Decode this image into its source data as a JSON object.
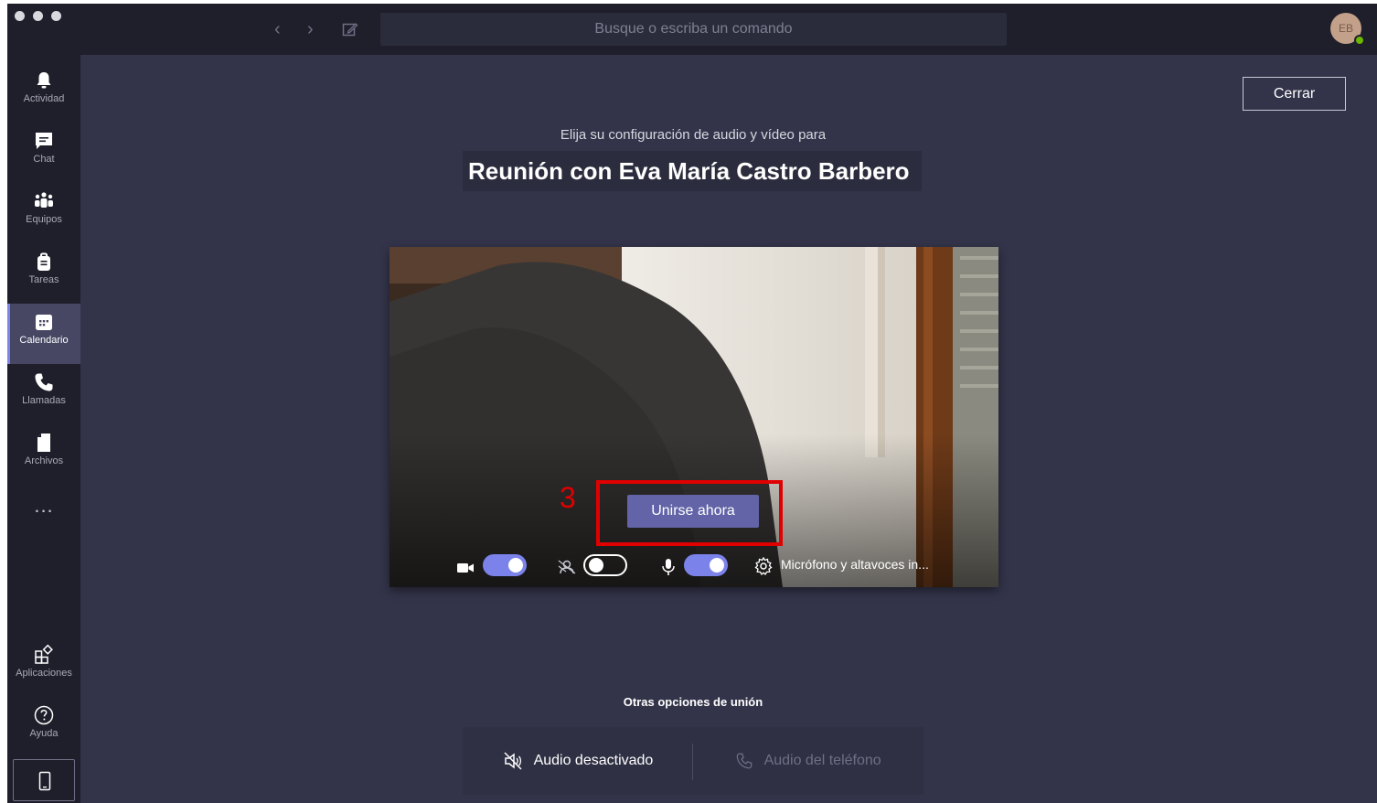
{
  "titlebar": {
    "search_placeholder": "Busque o escriba un comando",
    "avatar_initials": "EB",
    "presence_color": "#6bb700"
  },
  "rail": {
    "items": [
      {
        "label": "Actividad",
        "icon": "bell-icon"
      },
      {
        "label": "Chat",
        "icon": "chat-icon"
      },
      {
        "label": "Equipos",
        "icon": "teams-icon"
      },
      {
        "label": "Tareas",
        "icon": "tasks-icon"
      },
      {
        "label": "Calendario",
        "icon": "calendar-icon",
        "active": true
      },
      {
        "label": "Llamadas",
        "icon": "phone-icon"
      },
      {
        "label": "Archivos",
        "icon": "file-icon"
      }
    ],
    "more": "...",
    "apps_label": "Aplicaciones",
    "help_label": "Ayuda"
  },
  "main": {
    "close_label": "Cerrar",
    "subtitle": "Elija su configuración de audio y vídeo para",
    "meeting_title": "Reunión con Eva María Castro Barbero",
    "join_label": "Unirse ahora",
    "annotation_number": "3",
    "controls": {
      "camera_on": true,
      "background_blur_on": false,
      "mic_on": true,
      "device_settings": "Micrófono y altavoces in..."
    },
    "other_options": {
      "title": "Otras opciones de unión",
      "audio_off": "Audio desactivado",
      "phone_audio": "Audio del teléfono"
    }
  },
  "colors": {
    "accent": "#6264a7",
    "toggle_on": "#7b83eb",
    "annotation": "#e00000",
    "background": "#33344a",
    "rail": "#1f1f2b"
  }
}
